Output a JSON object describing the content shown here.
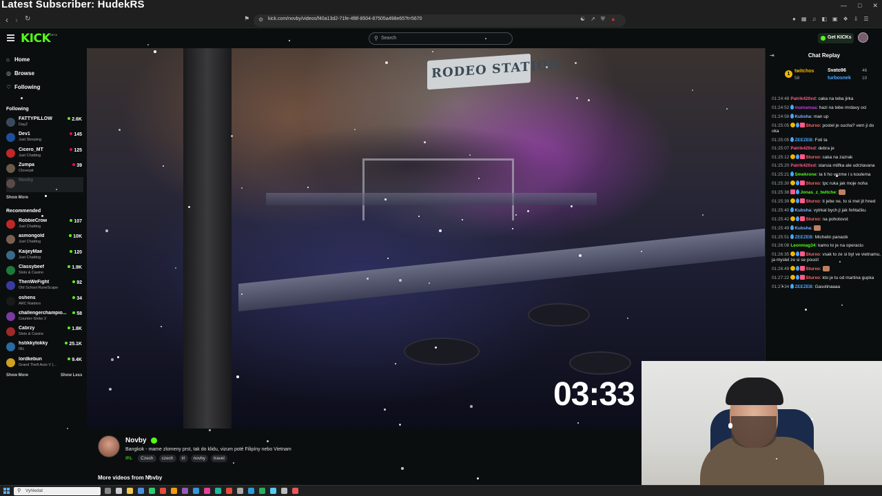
{
  "overlay": {
    "subscriber_text": "Latest Subscriber: HudekRS"
  },
  "browser": {
    "url": "kick.com/novby/videos/f40a13d2-71fe-4f8f-8504-87505a498e65?t=5670"
  },
  "header": {
    "logo": "KICK",
    "logo_sup": "BETA",
    "search_placeholder": "Search",
    "get_kicks_label": "Get KICKs"
  },
  "sidebar": {
    "nav": [
      {
        "label": "Home",
        "icon": "home-icon"
      },
      {
        "label": "Browse",
        "icon": "compass-icon"
      },
      {
        "label": "Following",
        "icon": "heart-icon"
      }
    ],
    "following_title": "Following",
    "following": [
      {
        "name": "FATTYPILLOW",
        "category": "DayZ",
        "viewers": "2.6K",
        "color": "#3a4a5a"
      },
      {
        "name": "Dev1",
        "category": "Just Sleeping",
        "viewers": "145",
        "color": "#1e4f9a"
      },
      {
        "name": "Cicero_MT",
        "category": "Just Chatting",
        "viewers": "125",
        "color": "#c02828"
      },
      {
        "name": "Zumpa",
        "category": "Cloverpit",
        "viewers": "39",
        "color": "#6a5a4a"
      },
      {
        "name": "Novby",
        "category": "",
        "viewers": "",
        "color": "#5a4a4a"
      }
    ],
    "following_show_more": "Show More",
    "recommended_title": "Recommended",
    "recommended": [
      {
        "name": "RobbieCrow",
        "category": "Just Chatting",
        "viewers": "107",
        "color": "#c02828"
      },
      {
        "name": "asmongold",
        "category": "Just Chatting",
        "viewers": "10K",
        "color": "#7a6050"
      },
      {
        "name": "KaijeyMae",
        "category": "Just Chatting",
        "viewers": "120",
        "color": "#3a6a8a"
      },
      {
        "name": "Classybeef",
        "category": "Slots & Casino",
        "viewers": "1.9K",
        "color": "#1e7a3a"
      },
      {
        "name": "ThenWeFight",
        "category": "Old School RuneScape",
        "viewers": "92",
        "color": "#3a3aa0"
      },
      {
        "name": "oshens",
        "category": "ARC Raiders",
        "viewers": "34",
        "color": "#1a1a1a"
      },
      {
        "name": "challengerchampio...",
        "category": "Counter-Strike 2",
        "viewers": "58",
        "color": "#7a3aa0"
      },
      {
        "name": "Cabrzy",
        "category": "Slots & Casino",
        "viewers": "1.8K",
        "color": "#a02828"
      },
      {
        "name": "hstikkytokky",
        "category": "IRL",
        "viewers": "25.1K",
        "color": "#2a6aa0"
      },
      {
        "name": "lordkebun",
        "category": "Grand Theft Auto V (...",
        "viewers": "9.4K",
        "color": "#d0a020"
      }
    ],
    "show_more": "Show More",
    "show_less": "Show Less"
  },
  "video": {
    "sign_text": "RODEO STATION",
    "timer": "03:33"
  },
  "stream_info": {
    "name": "Novby",
    "title": "Bangkok - mame zlomeny prst, tak do klidu,  vizum poté Filipíny nebo Vietnam",
    "category": "IRL",
    "tags": [
      "Czech",
      "czech",
      "irl",
      "novby",
      "travel"
    ],
    "more_videos": "More videos from Novby"
  },
  "chat": {
    "title": "Chat Replay",
    "top_gifters": [
      {
        "name": "twitchos",
        "count": "58",
        "color": "#f2b705"
      },
      {
        "name": "Svato96",
        "count": "46",
        "color": "#ffffff"
      },
      {
        "name": "turbosnek",
        "count": "10",
        "color": "#4aa8ff"
      }
    ],
    "top_gifter_rank": "1",
    "messages": [
      {
        "ts": "01:24:48",
        "user": "Patrik420xd",
        "color": "#ff5a8a",
        "badges": [],
        "text": "caka na teba jirka"
      },
      {
        "ts": "01:24:52",
        "user": "mamamaa",
        "color": "#c03adf",
        "badges": [
          "drop"
        ],
        "text": "hazi na tebe mrdavy oci"
      },
      {
        "ts": "01:24:58",
        "user": "Kubsha",
        "color": "#7fb2ff",
        "badges": [
          "drop"
        ],
        "text": "man up"
      },
      {
        "ts": "01:25:05",
        "user": "Sturxo",
        "color": "#ff6a6a",
        "badges": [
          "sub",
          "drop",
          "gift"
        ],
        "text": "postel je sucha? vem ji do oka"
      },
      {
        "ts": "01:25:05",
        "user": "ZEEZEB",
        "color": "#4aa8ff",
        "badges": [
          "drop"
        ],
        "text": "Foti ta"
      },
      {
        "ts": "01:25:07",
        "user": "Patrik420xd",
        "color": "#ff5a8a",
        "badges": [],
        "text": "debra je"
      },
      {
        "ts": "01:25:12",
        "user": "Sturxo",
        "color": "#ff6a6a",
        "badges": [
          "sub",
          "drop",
          "gift"
        ],
        "text": "caka na zazrak"
      },
      {
        "ts": "01:25:20",
        "user": "Patrik420xd",
        "color": "#ff5a8a",
        "badges": [],
        "text": "starsia milfka ale udrzlavana"
      },
      {
        "ts": "01:25:21",
        "user": "Smekrone",
        "color": "#53fc18",
        "badges": [
          "drop"
        ],
        "text": "ta ti ho vezme i s koulema"
      },
      {
        "ts": "01:25:30",
        "user": "Sturxo",
        "color": "#ff6a6a",
        "badges": [
          "sub",
          "drop",
          "gift"
        ],
        "text": "tpc ruka jak moje noha"
      },
      {
        "ts": "01:25:38",
        "user": "Jonas_z_twitche",
        "color": "#53fc18",
        "badges": [
          "gift",
          "drop"
        ],
        "text": "",
        "emote": true
      },
      {
        "ts": "01:25:39",
        "user": "Sturxo",
        "color": "#ff6a6a",
        "badges": [
          "sub",
          "drop",
          "gift"
        ],
        "text": "ti jebe ne, to si mel jit hned"
      },
      {
        "ts": "01:25:40",
        "user": "Kubsha",
        "color": "#7fb2ff",
        "badges": [
          "drop"
        ],
        "text": "vytrkal bych ji jak řehtačku"
      },
      {
        "ts": "01:25:42",
        "user": "Sturxo",
        "color": "#ff6a6a",
        "badges": [
          "sub",
          "drop",
          "gift"
        ],
        "text": "na pohotovst"
      },
      {
        "ts": "01:25:49",
        "user": "Kubsha",
        "color": "#7fb2ff",
        "badges": [
          "drop"
        ],
        "text": "",
        "emote": true
      },
      {
        "ts": "01:25:51",
        "user": "ZEEZEB",
        "color": "#4aa8ff",
        "badges": [
          "drop"
        ],
        "text": "Michelin panacik"
      },
      {
        "ts": "01:26:08",
        "user": "Leonmag34",
        "color": "#53fc18",
        "badges": [],
        "text": "kamo to je na operaciu"
      },
      {
        "ts": "01:26:35",
        "user": "Sturxo",
        "color": "#ff6a6a",
        "badges": [
          "sub",
          "drop",
          "gift"
        ],
        "text": "vsak to ze si byl ve vietnamu, ja myslel ze si se poucil"
      },
      {
        "ts": "01:26:49",
        "user": "Sturxo",
        "color": "#ff6a6a",
        "badges": [
          "sub",
          "drop",
          "gift"
        ],
        "text": "",
        "emote": true
      },
      {
        "ts": "01:27:22",
        "user": "Sturxo",
        "color": "#ff6a6a",
        "badges": [
          "sub",
          "drop",
          "gift"
        ],
        "text": "kto je tu od martina gupka"
      },
      {
        "ts": "01:27:34",
        "user": "ZEEZEB",
        "color": "#4aa8ff",
        "badges": [
          "drop"
        ],
        "text": "Gasolinaaaa"
      }
    ]
  },
  "taskbar": {
    "search_placeholder": "Vyhledat"
  }
}
